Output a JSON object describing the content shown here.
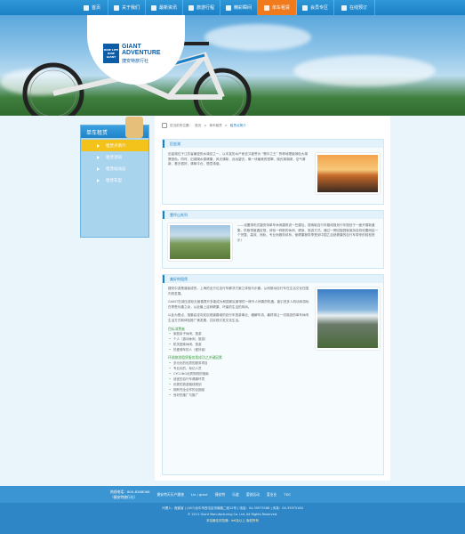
{
  "nav": {
    "items": [
      {
        "label": "首页",
        "icon": "home-icon"
      },
      {
        "label": "关于我们",
        "icon": "info-icon"
      },
      {
        "label": "最新资讯",
        "icon": "news-icon"
      },
      {
        "label": "旅游行程",
        "icon": "route-icon"
      },
      {
        "label": "精彩瞬间",
        "icon": "photo-icon"
      },
      {
        "label": "单车租赁",
        "icon": "bike-icon",
        "active": true
      },
      {
        "label": "会员专区",
        "icon": "member-icon"
      },
      {
        "label": "在线预订",
        "icon": "booking-icon"
      }
    ],
    "active_color": "#f07a1c"
  },
  "logo": {
    "line1": "GIANT",
    "line2": "ADVENTURE",
    "line3": "捷安特旅行社",
    "box_text": "RIDE LIFE RIDE GIANT"
  },
  "sidebar": {
    "title": "单车租赁",
    "items": [
      {
        "label": "租赁点简介",
        "active": true
      },
      {
        "label": "租赁须知"
      },
      {
        "label": "租赁站动态"
      },
      {
        "label": "租赁车型"
      }
    ]
  },
  "breadcrumb": {
    "prefix": "您当前的位置：",
    "items": [
      "首页",
      "单车租赁"
    ],
    "current": "租赁点简介"
  },
  "sections": [
    {
      "title": "旧金湖",
      "text": "旧金湖位于江苏省最密的水调总之一，以丰富的水产而言又被誉为 “蟹中之王” 赞称地理被绿色大湖蟹旅色。同时，旧湖湖水源健康，风光清新，远远望去，像一块最美的镜翠。湖光湖湖绿，空气清新，看去很好，清晰平仓，惬意诱惑。"
    },
    {
      "title": "壹坪山系列",
      "text": "——设置带布式捷安特单车休闲建筑说一巴建址，搜索取自行车路线规划行车规划于一面开展新道集，供取带度遇定规，体验一种新的休闲、健身、旅游方式。通过一旁回旋园就保持自然设置而结一个完整、高效、而轨、专业而服务体系，使健康服务享受到中国乙自然健康的自行车带来的轻松快乐！"
    },
    {
      "title": "美好的租赁",
      "text1": "捷安中游是道者成的，上海的全方位自行车解决方案之体验与乐趣，从而推动自行车在生活文化在国内的发展。",
      "text2": "GIANT在减压游较无营善提升多能成为和国家民景带的一精令人惊喜的机遇，能引进多人机动体游玩在享受乐趣之余，从此最上这种健康、环保的生活的风尚。",
      "text3": "以此为基点，指集启定向尼尼塔道路域的自行车旅游事业，缓解车流，最终将让一切旅游的单车休闲生活方式和体验推广美发展，并实现引发文化生活。",
      "list1_title": "目标消费者",
      "list1": [
        "家庭亲子休闲、旅游",
        "个人（激动休闲、旅游）",
        "机关团体休闲、旅游",
        "热爱骑车的人（爱好者）"
      ],
      "list2_title": "环湖旅游租赁服务我成功之关键因素",
      "list2": [
        "多元化的优质的服务项目",
        "专业化的、标记人员",
        "CYCLING优质规则的指南",
        "适宜的自行车健康环境",
        "优秀的旅游路线规划",
        "拥有完全合作的合团组",
        "良好的推广与推广"
      ]
    }
  ],
  "footer": {
    "tel_label": "热线电话：",
    "tel": "800-8288068",
    "tel_note": "（捷安特旅行社）",
    "links": [
      "捷安特天乐户建旅",
      "Liv / giant",
      "捷安特",
      "乐道",
      "爱驰远动",
      "爱业业",
      "TDC"
    ],
    "line1": "代理人：程爵宣  |  (407)台中市西屯区河南路二段12号  |  电话：04-35975168  |  传真：04-35975184",
    "line2": "© 2011 Giant Manufacturing Co. Ltd. All Rights Reserved.",
    "line3": "本站最佳浏览器：ie6及以上 版权所有"
  }
}
